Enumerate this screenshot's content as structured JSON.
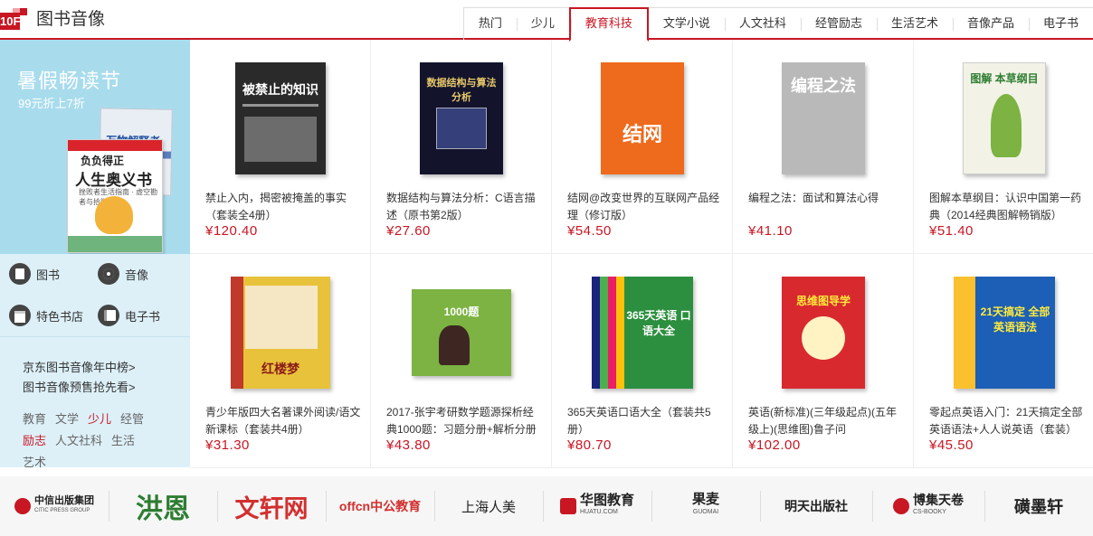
{
  "header": {
    "floor_num": "10F",
    "title": "图书音像"
  },
  "tabs": [
    "热门",
    "少儿",
    "教育科技",
    "文学小说",
    "人文社科",
    "经管励志",
    "生活艺术",
    "音像产品",
    "电子书"
  ],
  "active_tab": "教育科技",
  "promo": {
    "title": "暑假畅读节",
    "subtitle": "99元折上7折",
    "book_top": "万物解释者",
    "book_main_top": "负负得正",
    "book_main": "人生奥义书",
    "book_main_sub": "挫败者生活指南 · 虚空勘者与拾微"
  },
  "categories": [
    {
      "label": "图书",
      "icon": "book-icon"
    },
    {
      "label": "音像",
      "icon": "disc-icon"
    },
    {
      "label": "特色书店",
      "icon": "shop-icon"
    },
    {
      "label": "电子书",
      "icon": "ebook-icon"
    }
  ],
  "side_links": [
    "京东图书音像年中榜>",
    "图书音像预售抢先看>"
  ],
  "tags": [
    {
      "label": "教育",
      "hot": false
    },
    {
      "label": "文学",
      "hot": false
    },
    {
      "label": "少儿",
      "hot": true
    },
    {
      "label": "经管",
      "hot": false
    },
    {
      "label": "励志",
      "hot": true
    },
    {
      "label": "人文社科",
      "hot": false
    },
    {
      "label": "生活",
      "hot": false
    },
    {
      "label": "艺术",
      "hot": false
    }
  ],
  "products": [
    {
      "title": "禁止入内，揭密被掩盖的事实（套装全4册）",
      "price": "¥120.40",
      "cover_text": "被禁止的知识",
      "color": "#2a2a2a"
    },
    {
      "title": "数据结构与算法分析：C语言描述（原书第2版）",
      "price": "¥27.60",
      "cover_text": "数据结构与算法分析",
      "color": "#13142c"
    },
    {
      "title": "结网@改变世界的互联网产品经理（修订版）",
      "price": "¥54.50",
      "cover_text": "结网",
      "color": "#ee6a1c"
    },
    {
      "title": "编程之法：面试和算法心得",
      "price": "¥41.10",
      "cover_text": "编程之法",
      "color": "#b9b9b9"
    },
    {
      "title": "图解本草纲目：认识中国第一药典（2014经典图解畅销版）",
      "price": "¥51.40",
      "cover_text": "图解 本草纲目",
      "color": "#f2f2e6"
    },
    {
      "title": "青少年版四大名著课外阅读/语文新课标（套装共4册）",
      "price": "¥31.30",
      "cover_text": "红楼梦",
      "color": "#e8c23a"
    },
    {
      "title": "2017-张宇考研数学题源探析经典1000题：习题分册+解析分册",
      "price": "¥43.80",
      "cover_text": "1000题",
      "color": "#7cb342"
    },
    {
      "title": "365天英语口语大全（套装共5册）",
      "price": "¥80.70",
      "cover_text": "365天英语 口语大全",
      "color": "#2c8f3f"
    },
    {
      "title": "英语(新标准)(三年级起点)(五年级上)(思维图)鲁子问",
      "price": "¥102.00",
      "cover_text": "思维图导学",
      "color": "#d8292f"
    },
    {
      "title": "零起点英语入门：21天搞定全部英语语法+人人说英语（套装）",
      "price": "¥45.50",
      "cover_text": "21天搞定 全部英语语法",
      "color": "#1d5fb6"
    }
  ],
  "brands": [
    {
      "label": "中信出版集团",
      "sub": "CITIC PRESS GROUP",
      "color": "#c81623"
    },
    {
      "label": "洪恩",
      "sub": "",
      "color": "#2e7d32"
    },
    {
      "label": "文轩网",
      "sub": "",
      "color": "#d32f2f"
    },
    {
      "label": "offcn中公教育",
      "sub": "",
      "color": "#d32f2f"
    },
    {
      "label": "上海人美",
      "sub": "",
      "color": "#222"
    },
    {
      "label": "华图教育",
      "sub": "HUATU.COM",
      "color": "#c81623"
    },
    {
      "label": "果麦",
      "sub": "GUOMAI",
      "color": "#222"
    },
    {
      "label": "明天出版社",
      "sub": "",
      "color": "#222"
    },
    {
      "label": "博集天卷",
      "sub": "CS-BOOKY",
      "color": "#c81623"
    },
    {
      "label": "磺墨轩",
      "sub": "",
      "color": "#c81623"
    }
  ]
}
